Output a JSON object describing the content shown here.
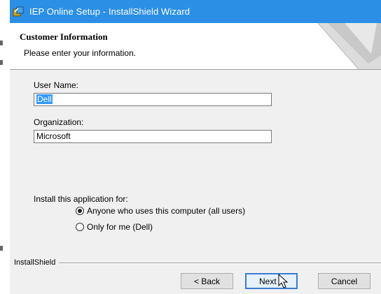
{
  "window": {
    "title": "IEP Online Setup - InstallShield Wizard"
  },
  "header": {
    "title": "Customer Information",
    "subtitle": "Please enter your information."
  },
  "form": {
    "user_name_label": "User Name:",
    "user_name_value": "Dell",
    "organization_label": "Organization:",
    "organization_value": "Microsoft",
    "install_for_label": "Install this application for:",
    "options": [
      {
        "label": "Anyone who uses this computer (all users)",
        "selected": true
      },
      {
        "label": "Only for me (Dell)",
        "selected": false
      }
    ]
  },
  "footer": {
    "brand": "InstallShield",
    "back_label": "< Back",
    "next_label": "Next >",
    "cancel_label": "Cancel"
  },
  "colors": {
    "titlebar": "#2b8fe5",
    "selection": "#3399ff"
  }
}
